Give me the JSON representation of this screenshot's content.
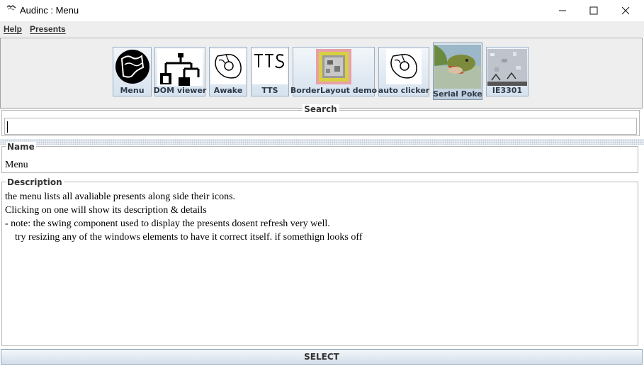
{
  "window": {
    "title": "Audinc : Menu",
    "controls": {
      "minimize": "—",
      "maximize": "☐",
      "close": "✕"
    }
  },
  "menubar": {
    "items": [
      {
        "label": "Help"
      },
      {
        "label": "Presents"
      }
    ]
  },
  "toolbar": {
    "items": [
      {
        "label": "Menu",
        "icon": "menu-globe-icon"
      },
      {
        "label": "DOM viewer",
        "icon": "tree-diagram-icon"
      },
      {
        "label": "Awake",
        "icon": "mouse-sketch-icon"
      },
      {
        "label": "TTS",
        "icon": "tts-text-icon"
      },
      {
        "label": "BorderLayout demo",
        "icon": "noise-pattern-icon"
      },
      {
        "label": "auto clicker",
        "icon": "mouse-sketch-icon"
      },
      {
        "label": "Serial Poke",
        "icon": "fish-photo-icon"
      },
      {
        "label": "IE3301",
        "icon": "static-noise-icon"
      }
    ]
  },
  "search": {
    "label": "Search",
    "value": ""
  },
  "details": {
    "name_label": "Name",
    "name_value": "Menu",
    "description_label": "Description",
    "description_lines": [
      "the menu lists all avaliable presents along side their icons.",
      "Clicking on one will show its description & details",
      "- note: the swing component used to display the presents dosent refresh very well.",
      "    try resizing any of the windows elements to have it correct itself. if somethign looks off"
    ]
  },
  "select_button": {
    "label": "SELECT"
  }
}
